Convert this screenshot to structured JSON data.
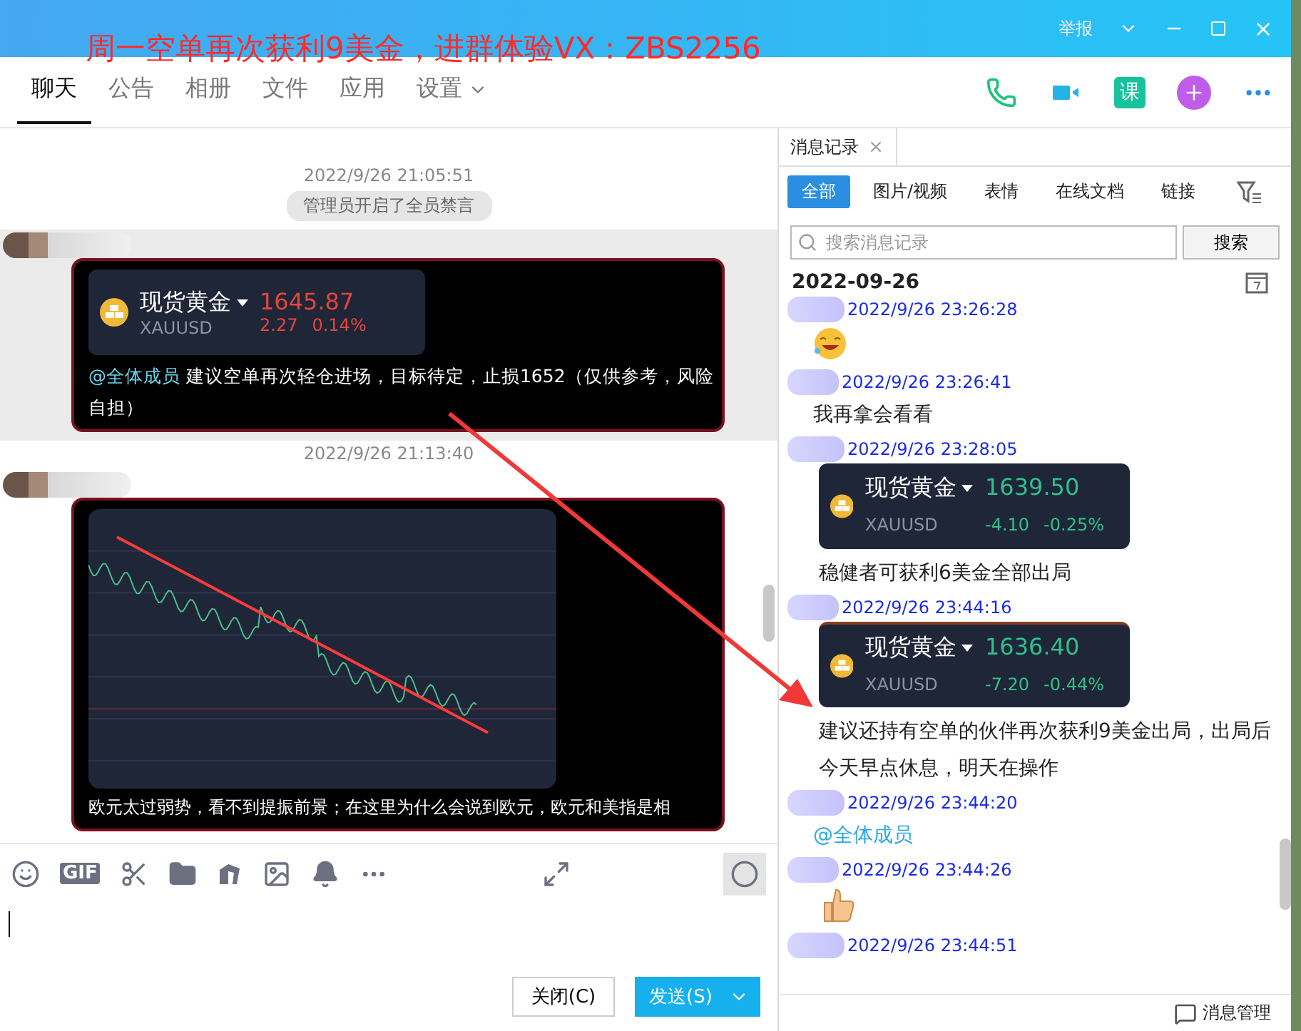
{
  "overlay_caption": "周一空单再次获利9美金，进群体验VX：ZBS2256",
  "title_bar": {
    "report": "举报"
  },
  "nav_tabs": [
    {
      "label": "聊天",
      "selected": true,
      "has_menu": false
    },
    {
      "label": "公告",
      "selected": false,
      "has_menu": false
    },
    {
      "label": "相册",
      "selected": false,
      "has_menu": false
    },
    {
      "label": "文件",
      "selected": false,
      "has_menu": false
    },
    {
      "label": "应用",
      "selected": false,
      "has_menu": false
    },
    {
      "label": "设置",
      "selected": false,
      "has_menu": true
    }
  ],
  "nav_actions": {
    "course_label": "课"
  },
  "chat": [
    {
      "kind": "time",
      "text": "2022/9/26 21:05:51"
    },
    {
      "kind": "system",
      "text": "管理员开启了全员禁言"
    },
    {
      "kind": "card_message",
      "highlighted": true,
      "card": {
        "name": "现货黄金",
        "symbol": "XAUUSD",
        "price": "1645.87",
        "change": "2.27",
        "percent": "0.14%",
        "color": "#e8443a"
      },
      "mention": "@全体成员",
      "text": "建议空单再次轻仓进场，目标待定，止损1652（仅供参考，风险自担）"
    },
    {
      "kind": "time",
      "text": "2022/9/26 21:13:40"
    },
    {
      "kind": "image_message",
      "highlighted": false,
      "text": "欧元太过弱势，看不到提振前景；在这里为什么会说到欧元，欧元和美指是相"
    }
  ],
  "input_toolbar": {
    "gif_label": "GIF"
  },
  "buttons": {
    "close": "关闭(C)",
    "send": "发送(S)"
  },
  "history": {
    "tab": "消息记录",
    "filters": [
      {
        "label": "全部",
        "selected": true
      },
      {
        "label": "图片/视频",
        "selected": false
      },
      {
        "label": "表情",
        "selected": false
      },
      {
        "label": "在线文档",
        "selected": false
      },
      {
        "label": "链接",
        "selected": false
      }
    ],
    "search": {
      "placeholder": "搜索消息记录",
      "button": "搜索"
    },
    "date": "2022-09-26",
    "records": [
      {
        "time": "2022/9/26 23:26:28",
        "kind": "laugh"
      },
      {
        "time": "2022/9/26 23:26:41",
        "kind": "text",
        "text": "我再拿会看看"
      },
      {
        "time": "2022/9/26 23:28:05",
        "kind": "card",
        "card": {
          "name": "现货黄金",
          "symbol": "XAUUSD",
          "price": "1639.50",
          "change": "-4.10",
          "percent": "-0.25%",
          "color": "#2fc08a"
        },
        "text": "稳健者可获利6美金全部出局"
      },
      {
        "time": "2022/9/26 23:44:16",
        "kind": "card",
        "card": {
          "name": "现货黄金",
          "symbol": "XAUUSD",
          "price": "1636.40",
          "change": "-7.20",
          "percent": "-0.44%",
          "color": "#2fc08a"
        },
        "text": "建议还持有空单的伙伴再次获利9美金出局，出局后今天早点休息，明天在操作"
      },
      {
        "time": "2022/9/26 23:44:20",
        "kind": "mention",
        "text": "@全体成员"
      },
      {
        "time": "2022/9/26 23:44:26",
        "kind": "thumbs"
      },
      {
        "time": "2022/9/26 23:44:51",
        "kind": "none"
      }
    ],
    "footer": "消息管理"
  }
}
